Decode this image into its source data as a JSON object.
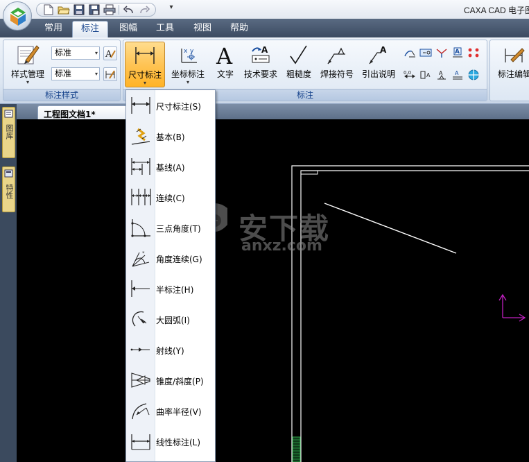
{
  "app": {
    "title": "CAXA CAD 电子图"
  },
  "quick_access": {
    "icons": [
      "new-file-icon",
      "open-folder-icon",
      "save-icon",
      "save-as-icon",
      "print-icon",
      "undo-icon",
      "redo-icon"
    ],
    "more": "▾"
  },
  "ribbon_tabs": [
    {
      "label": "常用",
      "active": false
    },
    {
      "label": "标注",
      "active": true
    },
    {
      "label": "图幅",
      "active": false
    },
    {
      "label": "工具",
      "active": false
    },
    {
      "label": "视图",
      "active": false
    },
    {
      "label": "帮助",
      "active": false
    }
  ],
  "groups": {
    "style": {
      "label": "标注样式",
      "manager_label": "样式管理",
      "combo1": "标准",
      "combo2": "标准"
    },
    "annotation": {
      "label": "标注",
      "buttons": [
        {
          "label": "尺寸标注",
          "pressed": true
        },
        {
          "label": "坐标标注"
        },
        {
          "label": "文字"
        },
        {
          "label": "技术要求"
        },
        {
          "label": "粗糙度"
        },
        {
          "label": "焊接符号"
        },
        {
          "label": "引出说明"
        }
      ]
    },
    "edit": {
      "label": "标注编辑"
    }
  },
  "side_panels": [
    {
      "label": "图库",
      "icon": "library-icon"
    },
    {
      "label": "特性",
      "icon": "properties-icon"
    }
  ],
  "document": {
    "tab_label": "工程图文档1*",
    "close_glyph": "×"
  },
  "dimension_menu": {
    "items": [
      {
        "label": "尺寸标注(S)",
        "icon": "dimension-icon"
      },
      {
        "label": "基本(B)",
        "icon": "basic-dimension-icon"
      },
      {
        "label": "基线(A)",
        "icon": "baseline-dimension-icon"
      },
      {
        "label": "连续(C)",
        "icon": "continuous-dimension-icon"
      },
      {
        "label": "三点角度(T)",
        "icon": "three-point-angle-icon"
      },
      {
        "label": "角度连续(G)",
        "icon": "angle-continuous-icon"
      },
      {
        "label": "半标注(H)",
        "icon": "half-dimension-icon"
      },
      {
        "label": "大圆弧(I)",
        "icon": "large-arc-icon"
      },
      {
        "label": "射线(Y)",
        "icon": "ray-dimension-icon"
      },
      {
        "label": "锥度/斜度(P)",
        "icon": "taper-slope-icon"
      },
      {
        "label": "曲率半径(V)",
        "icon": "curvature-radius-icon"
      },
      {
        "label": "线性标注(L)",
        "icon": "linear-dimension-icon"
      }
    ]
  },
  "watermark": {
    "big": "安下载",
    "small": "anxz.com"
  },
  "colors": {
    "canvas": "#000000",
    "drawing_lines": "#ffffff",
    "ucs_axis": "#c020c0",
    "menu_highlight": "#ffc455",
    "frame_hatch": "#2ea84a"
  }
}
